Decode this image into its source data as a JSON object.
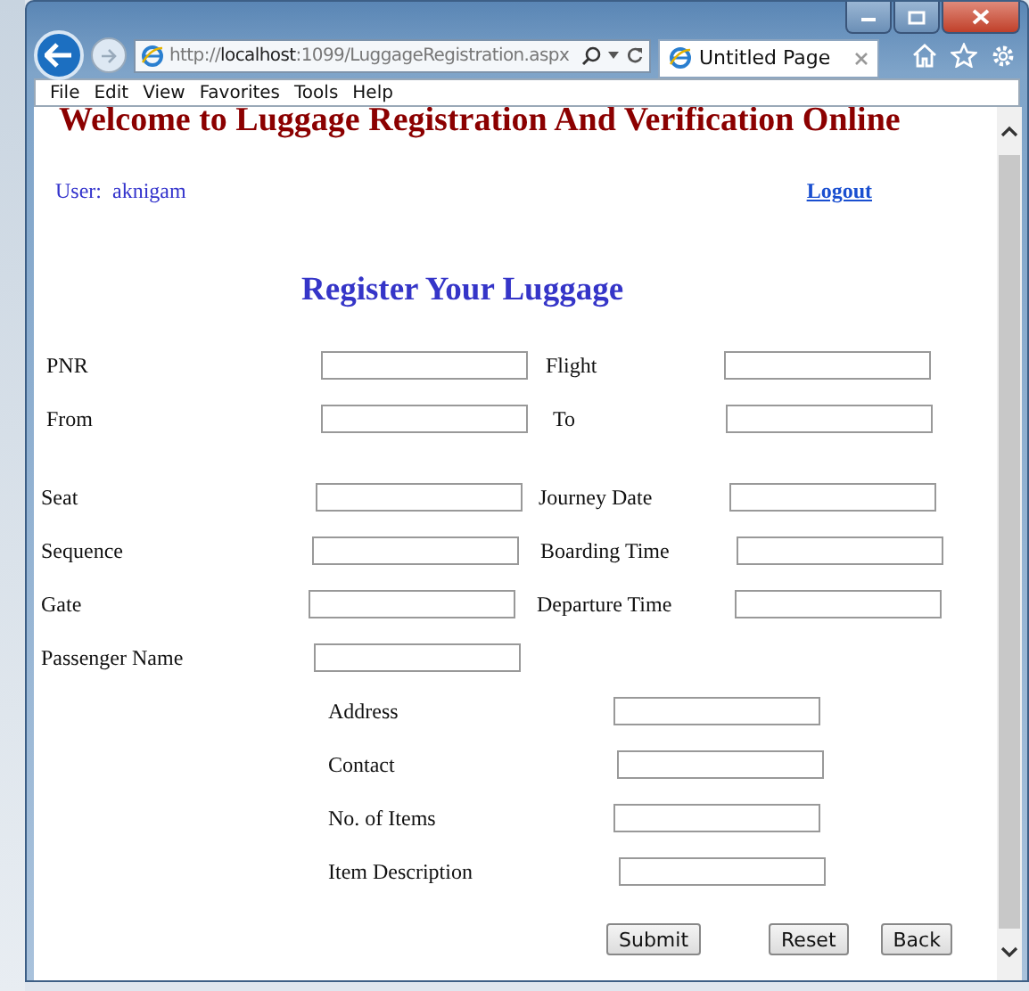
{
  "browser": {
    "address": "http://**localhost**:1099/LuggageRegistration.aspx",
    "tab": {
      "title": "Untitled Page",
      "selected": true
    },
    "menu": [
      "File",
      "Edit",
      "View",
      "Favorites",
      "Tools",
      "Help"
    ]
  },
  "page": {
    "heading": "Welcome to Luggage Registration And Verification Online",
    "user_label": "User:",
    "user_name": "aknigam",
    "logout": "Logout",
    "form_title": "Register Your Luggage",
    "paired_rows": [
      {
        "label": "PNR",
        "label_2": "Flight"
      },
      {
        "label": "From",
        "label_2": "To"
      },
      {
        "label": "Seat",
        "label_2": "Journey Date"
      },
      {
        "label": "Sequence",
        "label_2": "Boarding Time"
      },
      {
        "label": "Gate",
        "label_2": "Departure Time"
      },
      {
        "label": "Passenger Name"
      }
    ],
    "detail_rows": [
      {
        "label": "Address"
      },
      {
        "label": "Contact"
      },
      {
        "label": "No. of Items"
      },
      {
        "label": "Item Description"
      }
    ],
    "buttons": [
      "Submit",
      "Reset",
      "Back"
    ]
  }
}
